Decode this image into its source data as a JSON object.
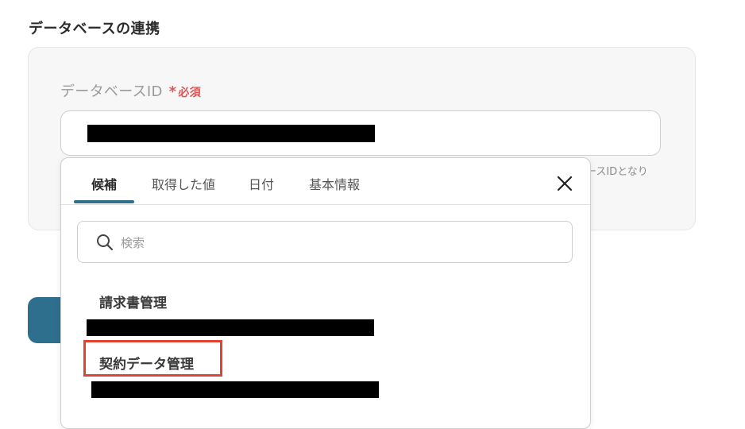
{
  "section": {
    "title": "データベースの連携"
  },
  "field": {
    "label": "データベースID",
    "required_mark": "*",
    "required_text": "必須",
    "hint_fragment": "ースIDとなり"
  },
  "popup": {
    "tabs": [
      {
        "label": "候補",
        "active": true
      },
      {
        "label": "取得した値",
        "active": false
      },
      {
        "label": "日付",
        "active": false
      },
      {
        "label": "基本情報",
        "active": false
      }
    ],
    "search": {
      "placeholder": "検索",
      "value": ""
    },
    "options": [
      {
        "label": "請求書管理"
      },
      {
        "label": "契約データ管理",
        "highlighted": true
      }
    ]
  },
  "colors": {
    "accent": "#2f6f8e",
    "required": "#e05656",
    "highlight": "#e0432f"
  },
  "icons": [
    "close-icon",
    "search-icon"
  ]
}
